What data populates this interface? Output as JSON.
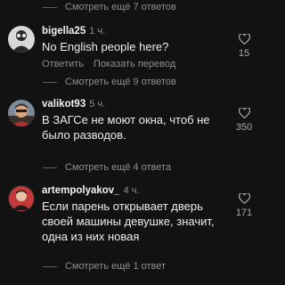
{
  "replies_toggles": [
    "Смотреть ещё 7 ответов",
    "Смотреть ещё 9 ответов",
    "Смотреть ещё 4 ответа",
    "Смотреть ещё 1 ответ"
  ],
  "comments": [
    {
      "username": "bigella25",
      "time": "1 ч.",
      "text": "No English people here?",
      "actions": [
        "Ответить",
        "Показать перевод"
      ],
      "likes": "15"
    },
    {
      "username": "valikot93",
      "time": "5 ч.",
      "text": "В ЗАГСе не моют окна, чтоб не было разводов.",
      "likes": "350"
    },
    {
      "username": "artempolyakov_",
      "time": "4 ч.",
      "text": "Если парень открывает дверь своей машины девушке, значит, одна из них новая",
      "likes": "171"
    }
  ],
  "colors": {
    "background": "#121212",
    "muted": "#8e8e8e"
  },
  "icons": {
    "like": "heart-outline-icon"
  }
}
